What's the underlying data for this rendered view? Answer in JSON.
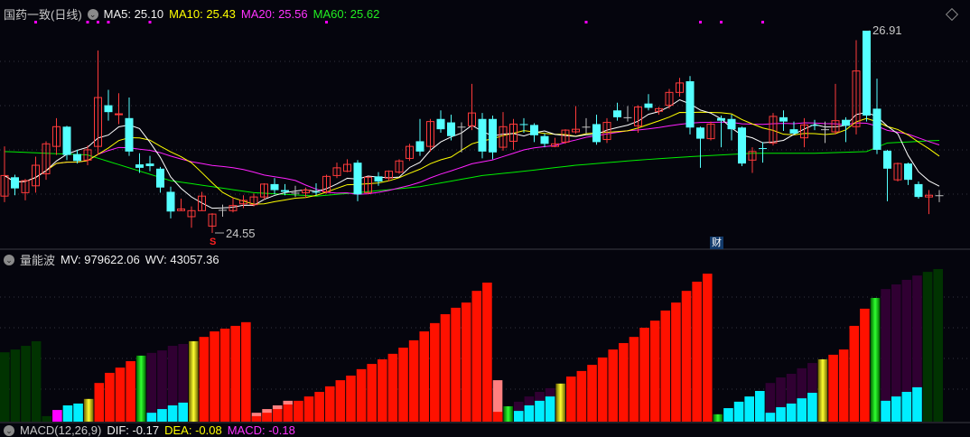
{
  "header": {
    "title": "国药一致(日线)",
    "ma5": "MA5: 25.10",
    "ma10": "MA10: 25.43",
    "ma20": "MA20: 25.56",
    "ma60": "MA60: 25.62",
    "high_label": "26.91",
    "low_label": "24.55",
    "s_marker": "S",
    "cai_badge": "财"
  },
  "volume_panel": {
    "title": "量能波",
    "mv": "MV: 979622.06",
    "wv": "WV: 43057.36"
  },
  "macd_panel": {
    "title": "MACD(12,26,9)",
    "dif": "DIF: -0.17",
    "dea": "DEA: -0.08",
    "macd": "MACD: -0.18"
  },
  "colors": {
    "up": "#ff3a3a",
    "down": "#55ffff",
    "doji": "#c0c0c0",
    "ma5": "#ffffff",
    "ma10": "#ffff00",
    "ma20": "#ff22ff",
    "ma60": "#00ee00",
    "bar_R": "#ff1100",
    "bar_D": "#013301",
    "bar_M": "#ff00ff",
    "bar_C": "#00eeff",
    "bar_P": "#300032",
    "bar_K": "#ff8080"
  },
  "chart_data": {
    "type": "candlestick",
    "price_range": [
      24.55,
      26.91
    ],
    "candles_ohlc": [
      [
        24.98,
        25.22,
        25.56,
        24.91
      ],
      [
        25.2,
        25.07,
        25.23,
        24.99
      ],
      [
        25.02,
        25.16,
        25.18,
        24.93
      ],
      [
        25.1,
        25.34,
        25.44,
        25.02
      ],
      [
        25.24,
        25.59,
        25.62,
        25.17
      ],
      [
        25.56,
        25.79,
        25.89,
        25.46
      ],
      [
        25.79,
        25.46,
        25.8,
        25.4
      ],
      [
        25.47,
        25.39,
        25.52,
        25.36
      ],
      [
        25.4,
        25.52,
        25.57,
        25.34
      ],
      [
        25.56,
        26.13,
        26.68,
        25.46
      ],
      [
        26.04,
        25.96,
        26.22,
        25.86
      ],
      [
        25.93,
        25.94,
        26.18,
        25.82
      ],
      [
        25.89,
        25.5,
        26.13,
        25.45
      ],
      [
        25.35,
        25.31,
        25.48,
        25.25
      ],
      [
        25.36,
        25.33,
        25.45,
        25.27
      ],
      [
        25.3,
        25.08,
        25.32,
        25.02
      ],
      [
        25.03,
        24.8,
        25.09,
        24.72
      ],
      [
        24.81,
        24.83,
        24.95,
        24.81
      ],
      [
        24.74,
        24.81,
        24.86,
        24.61
      ],
      [
        24.81,
        24.98,
        25.03,
        24.81
      ],
      [
        24.63,
        24.77,
        24.78,
        24.55
      ],
      [
        24.82,
        24.82,
        24.88,
        24.74
      ],
      [
        24.81,
        24.87,
        24.96,
        24.79
      ],
      [
        24.89,
        24.93,
        24.99,
        24.84
      ],
      [
        24.88,
        24.97,
        25.01,
        24.86
      ],
      [
        24.97,
        25.12,
        25.13,
        24.94
      ],
      [
        25.12,
        25.05,
        25.19,
        25.0
      ],
      [
        25.05,
        25.03,
        25.12,
        24.99
      ],
      [
        25.02,
        25.02,
        25.1,
        24.97
      ],
      [
        25.02,
        25.05,
        25.08,
        24.96
      ],
      [
        25.03,
        25.02,
        25.13,
        24.99
      ],
      [
        25.03,
        25.21,
        25.23,
        25.01
      ],
      [
        25.22,
        25.31,
        25.37,
        25.19
      ],
      [
        25.27,
        25.35,
        25.41,
        25.26
      ],
      [
        25.37,
        25.0,
        25.4,
        24.92
      ],
      [
        25.02,
        25.2,
        25.21,
        25.0
      ],
      [
        25.21,
        25.15,
        25.26,
        25.1
      ],
      [
        25.19,
        25.27,
        25.28,
        25.15
      ],
      [
        25.26,
        25.39,
        25.41,
        25.24
      ],
      [
        25.42,
        25.56,
        25.59,
        25.39
      ],
      [
        25.62,
        25.5,
        25.88,
        25.45
      ],
      [
        25.56,
        25.85,
        25.88,
        25.5
      ],
      [
        25.88,
        25.76,
        25.98,
        25.72
      ],
      [
        25.84,
        25.68,
        25.93,
        25.63
      ],
      [
        25.79,
        25.79,
        25.84,
        25.49
      ],
      [
        25.8,
        25.95,
        26.29,
        25.75
      ],
      [
        25.88,
        25.5,
        25.95,
        25.42
      ],
      [
        25.88,
        25.49,
        25.92,
        25.41
      ],
      [
        25.55,
        25.79,
        25.96,
        25.51
      ],
      [
        25.62,
        25.82,
        25.88,
        25.52
      ],
      [
        25.82,
        25.81,
        25.89,
        25.72
      ],
      [
        25.81,
        25.69,
        25.83,
        25.61
      ],
      [
        25.68,
        25.59,
        25.71,
        25.55
      ],
      [
        25.56,
        25.59,
        25.66,
        25.55
      ],
      [
        25.61,
        25.75,
        25.76,
        25.59
      ],
      [
        25.73,
        25.76,
        26.03,
        25.71
      ],
      [
        25.79,
        25.79,
        25.89,
        25.71
      ],
      [
        25.82,
        25.61,
        25.93,
        25.58
      ],
      [
        25.64,
        25.84,
        25.89,
        25.6
      ],
      [
        25.98,
        25.9,
        26.07,
        25.86
      ],
      [
        25.9,
        25.9,
        26.03,
        25.85
      ],
      [
        25.8,
        26.02,
        26.04,
        25.72
      ],
      [
        26.06,
        26.01,
        26.17,
        25.98
      ],
      [
        25.97,
        26.0,
        26.02,
        25.93
      ],
      [
        26.04,
        26.19,
        26.23,
        26.0
      ],
      [
        26.19,
        26.3,
        26.36,
        26.14
      ],
      [
        26.32,
        25.78,
        26.38,
        25.7
      ],
      [
        25.78,
        25.65,
        25.79,
        25.31
      ],
      [
        25.65,
        25.82,
        25.85,
        25.63
      ],
      [
        25.89,
        25.86,
        25.92,
        25.55
      ],
      [
        25.88,
        25.76,
        25.93,
        25.63
      ],
      [
        25.78,
        25.36,
        25.79,
        25.33
      ],
      [
        25.4,
        25.5,
        25.55,
        25.25
      ],
      [
        25.54,
        25.53,
        25.61,
        25.37
      ],
      [
        25.6,
        25.91,
        25.95,
        25.57
      ],
      [
        25.9,
        25.85,
        25.98,
        25.74
      ],
      [
        25.76,
        25.71,
        25.85,
        25.7
      ],
      [
        25.66,
        25.81,
        25.89,
        25.55
      ],
      [
        25.81,
        25.8,
        25.87,
        25.75
      ],
      [
        25.76,
        25.76,
        25.85,
        25.6
      ],
      [
        25.73,
        25.86,
        26.29,
        25.7
      ],
      [
        25.87,
        25.8,
        25.9,
        25.61
      ],
      [
        25.79,
        26.44,
        26.8,
        25.7
      ],
      [
        26.91,
        25.92,
        26.91,
        25.85
      ],
      [
        26.0,
        25.52,
        26.35,
        25.47
      ],
      [
        25.51,
        25.3,
        25.52,
        24.92
      ],
      [
        25.17,
        25.36,
        25.37,
        25.15
      ],
      [
        25.36,
        25.17,
        25.37,
        25.11
      ],
      [
        25.12,
        24.97,
        25.15,
        24.95
      ],
      [
        24.97,
        24.99,
        25.05,
        24.77
      ],
      [
        24.99,
        24.99,
        25.05,
        24.91
      ]
    ],
    "ma60_keypoints": [
      [
        0,
        25.5
      ],
      [
        8,
        25.46
      ],
      [
        16,
        25.16
      ],
      [
        24,
        25.02
      ],
      [
        30,
        24.98
      ],
      [
        34,
        25.02
      ],
      [
        40,
        25.09
      ],
      [
        46,
        25.22
      ],
      [
        50,
        25.27
      ],
      [
        55,
        25.34
      ],
      [
        61,
        25.4
      ],
      [
        66,
        25.44
      ],
      [
        72,
        25.48
      ],
      [
        78,
        25.48
      ],
      [
        83,
        25.5
      ],
      [
        85,
        25.6
      ],
      [
        90,
        25.63
      ]
    ],
    "volume_bars": [
      [
        "D",
        22.6
      ],
      [
        "D",
        23.5
      ],
      [
        "D",
        24.7
      ],
      [
        "D",
        26.2
      ],
      [
        "D",
        1.8
      ],
      [
        "M",
        3.8
      ],
      [
        "C",
        5.3
      ],
      [
        "C",
        5.9
      ],
      [
        "G",
        7.4
      ],
      [
        "R",
        12.6
      ],
      [
        "R",
        15.9
      ],
      [
        "R",
        17.6
      ],
      [
        "R",
        19.7
      ],
      [
        "N",
        21.5
      ],
      [
        "P",
        22.4,
        2.9
      ],
      [
        "P",
        23.2,
        4.1
      ],
      [
        "P",
        24.7,
        5.3
      ],
      [
        "P",
        25.3,
        6.2
      ],
      [
        "G",
        26.2
      ],
      [
        "R",
        27.6
      ],
      [
        "R",
        29.4
      ],
      [
        "R",
        30.3
      ],
      [
        "R",
        31.2
      ],
      [
        "R",
        32.4
      ],
      [
        "K",
        1.8,
        2.9
      ],
      [
        "K",
        2.9,
        4.1
      ],
      [
        "K",
        4.1,
        5.3
      ],
      [
        "K",
        5.6,
        6.8
      ],
      [
        "R",
        6.8
      ],
      [
        "R",
        8.2
      ],
      [
        "R",
        9.7
      ],
      [
        "R",
        11.5
      ],
      [
        "R",
        13.5
      ],
      [
        "R",
        15.0
      ],
      [
        "R",
        17.1
      ],
      [
        "R",
        18.8
      ],
      [
        "R",
        20.3
      ],
      [
        "R",
        22.1
      ],
      [
        "R",
        24.1
      ],
      [
        "R",
        26.5
      ],
      [
        "R",
        29.4
      ],
      [
        "R",
        32.1
      ],
      [
        "R",
        35.0
      ],
      [
        "R",
        37.1
      ],
      [
        "R",
        38.8
      ],
      [
        "R",
        42.6
      ],
      [
        "R",
        45.3
      ],
      [
        "K",
        3.2,
        13.5
      ],
      [
        "N",
        5.0
      ],
      [
        "P",
        6.5,
        3.5
      ],
      [
        "P",
        8.2,
        5.3
      ],
      [
        "P",
        9.7,
        6.8
      ],
      [
        "P",
        10.9,
        8.2
      ],
      [
        "G",
        12.4
      ],
      [
        "R",
        14.7
      ],
      [
        "R",
        16.5
      ],
      [
        "R",
        18.5
      ],
      [
        "R",
        20.9
      ],
      [
        "R",
        23.5
      ],
      [
        "R",
        25.6
      ],
      [
        "R",
        27.6
      ],
      [
        "R",
        30.6
      ],
      [
        "R",
        32.9
      ],
      [
        "R",
        36.2
      ],
      [
        "R",
        38.8
      ],
      [
        "R",
        42.6
      ],
      [
        "R",
        45.6
      ],
      [
        "R",
        48.2
      ],
      [
        "N",
        2.4
      ],
      [
        "C",
        4.4
      ],
      [
        "C",
        6.5
      ],
      [
        "C",
        8.2
      ],
      [
        "C",
        10.0
      ],
      [
        "P",
        12.6,
        2.9
      ],
      [
        "P",
        14.4,
        4.7
      ],
      [
        "P",
        15.6,
        5.9
      ],
      [
        "P",
        17.4,
        7.6
      ],
      [
        "P",
        19.1,
        9.4
      ],
      [
        "G",
        20.3
      ],
      [
        "R",
        21.8
      ],
      [
        "R",
        23.5
      ],
      [
        "R",
        31.2
      ],
      [
        "R",
        36.8
      ],
      [
        "N",
        40.3
      ],
      [
        "P",
        43.2,
        6.8
      ],
      [
        "P",
        44.7,
        8.2
      ],
      [
        "P",
        46.2,
        9.7
      ],
      [
        "P",
        47.6,
        11.2
      ],
      [
        "D",
        48.8
      ],
      [
        "D",
        49.7
      ]
    ],
    "signal_dots_candle_index": [
      3,
      8,
      9,
      10,
      14,
      31,
      56,
      67,
      69,
      73
    ]
  }
}
